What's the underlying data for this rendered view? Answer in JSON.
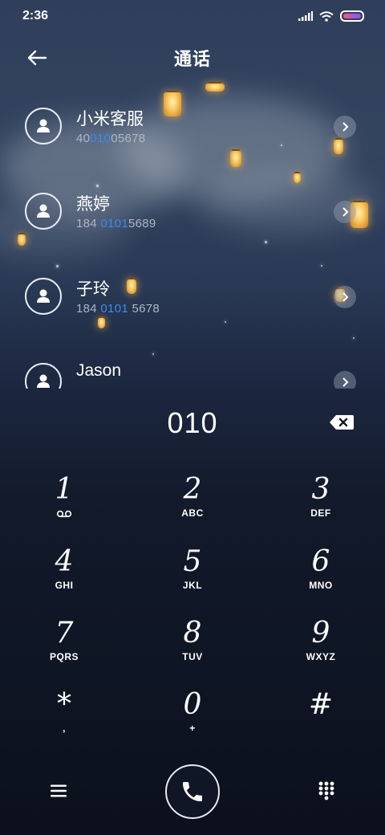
{
  "status": {
    "time": "2:36"
  },
  "header": {
    "title": "通话"
  },
  "contacts": [
    {
      "name": "小米客服",
      "number_pre": "40",
      "number_hl": "010",
      "number_post": "05678"
    },
    {
      "name": "燕婷",
      "number_pre": "184 ",
      "number_hl": "0101",
      "number_post": "5689"
    },
    {
      "name": "子玲",
      "number_pre": "184 ",
      "number_hl": "0101",
      "number_post": " 5678"
    },
    {
      "name": "Jason",
      "number_pre": "",
      "number_hl": "",
      "number_post": ""
    }
  ],
  "dialer": {
    "input": "010"
  },
  "keypad": [
    {
      "digit": "1",
      "letters": ""
    },
    {
      "digit": "2",
      "letters": "ABC"
    },
    {
      "digit": "3",
      "letters": "DEF"
    },
    {
      "digit": "4",
      "letters": "GHI"
    },
    {
      "digit": "5",
      "letters": "JKL"
    },
    {
      "digit": "6",
      "letters": "MNO"
    },
    {
      "digit": "7",
      "letters": "PQRS"
    },
    {
      "digit": "8",
      "letters": "TUV"
    },
    {
      "digit": "9",
      "letters": "WXYZ"
    },
    {
      "digit": "*",
      "letters": ","
    },
    {
      "digit": "0",
      "letters": "+"
    },
    {
      "digit": "#",
      "letters": ""
    }
  ],
  "icons": {
    "back": "back-arrow-icon",
    "avatar": "person-icon",
    "arrow": "chevron-right-icon",
    "backspace": "backspace-icon",
    "voicemail": "voicemail-icon",
    "menu": "menu-icon",
    "call": "phone-icon",
    "keypad": "keypad-icon"
  },
  "colors": {
    "highlight": "#3a8cf0"
  }
}
